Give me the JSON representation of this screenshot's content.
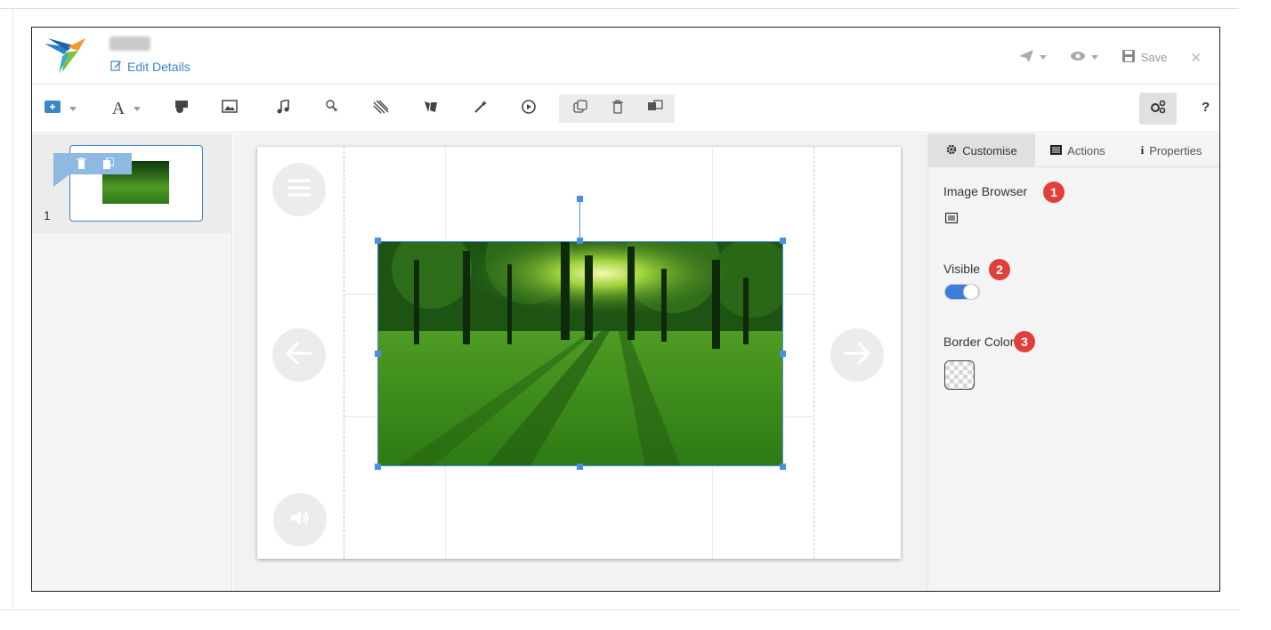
{
  "header": {
    "edit_details_label": "Edit Details",
    "save_label": "Save"
  },
  "toolbar": {
    "help_label": "?",
    "text_tool_label": "A"
  },
  "slides": [
    {
      "number": "1"
    }
  ],
  "properties_panel": {
    "tabs": [
      {
        "label": "Customise",
        "icon": "gear-icon",
        "active": true
      },
      {
        "label": "Actions",
        "icon": "list-icon",
        "active": false
      },
      {
        "label": "Properties",
        "icon": "info-icon",
        "active": false
      }
    ],
    "image_browser_label": "Image Browser",
    "visible_label": "Visible",
    "visible_value": true,
    "border_color_label": "Border Color",
    "badges": [
      "1",
      "2",
      "3"
    ]
  },
  "colors": {
    "accent": "#3d85c6",
    "selection": "#4a90e2",
    "badge": "#e0403a",
    "toggle_on": "#3d7ddb"
  }
}
